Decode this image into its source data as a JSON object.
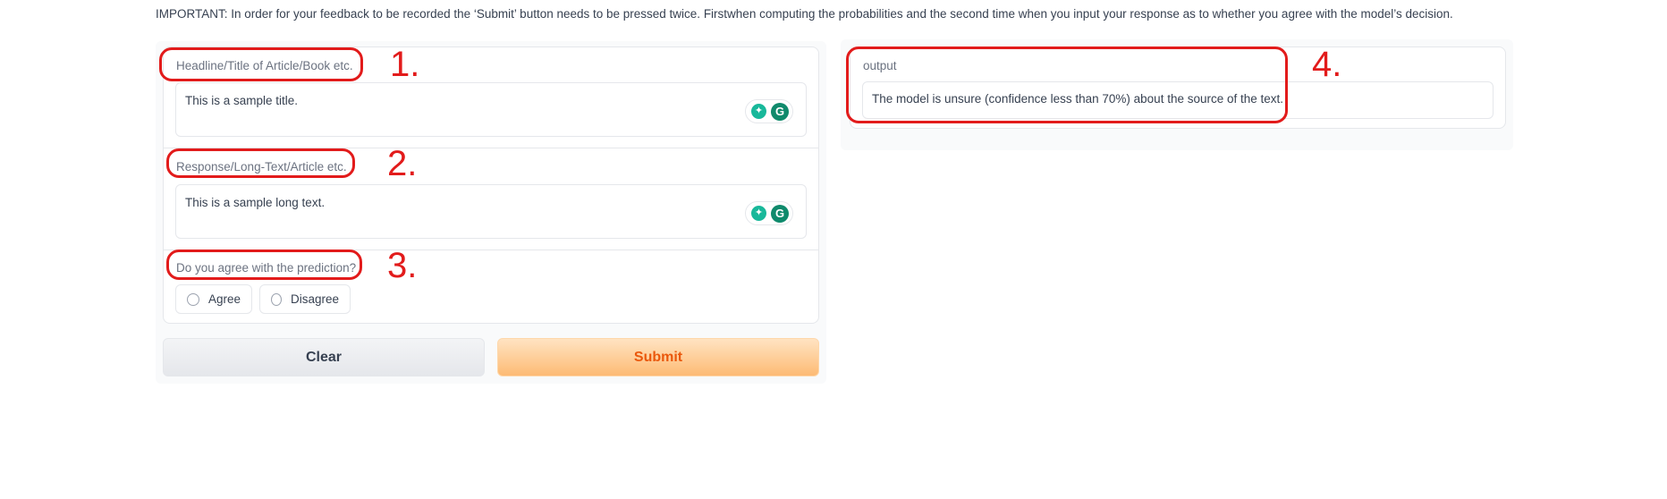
{
  "notice": "IMPORTANT: In order for your feedback to be recorded the ‘Submit’ button needs to be pressed twice. Firstwhen computing the probabilities and the second time when you input your response as to whether you agree with the model’s decision.",
  "headline": {
    "label": "Headline/Title of Article/Book etc.",
    "value": "This is a sample title."
  },
  "response": {
    "label": "Response/Long-Text/Article etc.",
    "value": "This is a sample long text."
  },
  "agree": {
    "label": "Do you agree with the prediction?",
    "options": [
      "Agree",
      "Disagree"
    ],
    "selected": null
  },
  "buttons": {
    "clear": "Clear",
    "submit": "Submit"
  },
  "output": {
    "label": "output",
    "value": "The model is unsure (confidence less than 70%) about the source of the text."
  },
  "annotations": [
    "1.",
    "2.",
    "3.",
    "4."
  ],
  "grammarly": {
    "g_letter": "G",
    "icons": [
      "grammarly-bulb-icon",
      "grammarly-g-icon"
    ]
  },
  "colors": {
    "annotation": "#e21b1b",
    "submit_text": "#ea580c",
    "submit_bg": "#fdbb74",
    "grammarly": "#0f8a6c"
  }
}
